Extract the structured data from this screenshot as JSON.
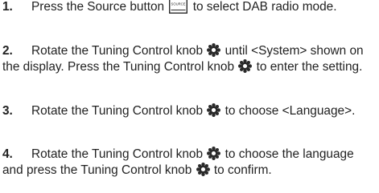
{
  "steps": [
    {
      "number": "1.",
      "text_a": "Press the Source button",
      "icon_label": "SOURCE",
      "text_b": "to select DAB radio mode."
    },
    {
      "number": "2.",
      "text_a": "Rotate the Tuning Control knob",
      "text_b": "until <System> shown on the display. Press the Tuning Control knob",
      "text_c": "to enter the setting."
    },
    {
      "number": "3.",
      "text_a": "Rotate the Tuning Control knob",
      "text_b": "to choose <Language>."
    },
    {
      "number": "4.",
      "text_a": "Rotate the Tuning Control knob",
      "text_b": "to choose the language and press the Tuning Control knob",
      "text_c": "to confirm."
    }
  ]
}
